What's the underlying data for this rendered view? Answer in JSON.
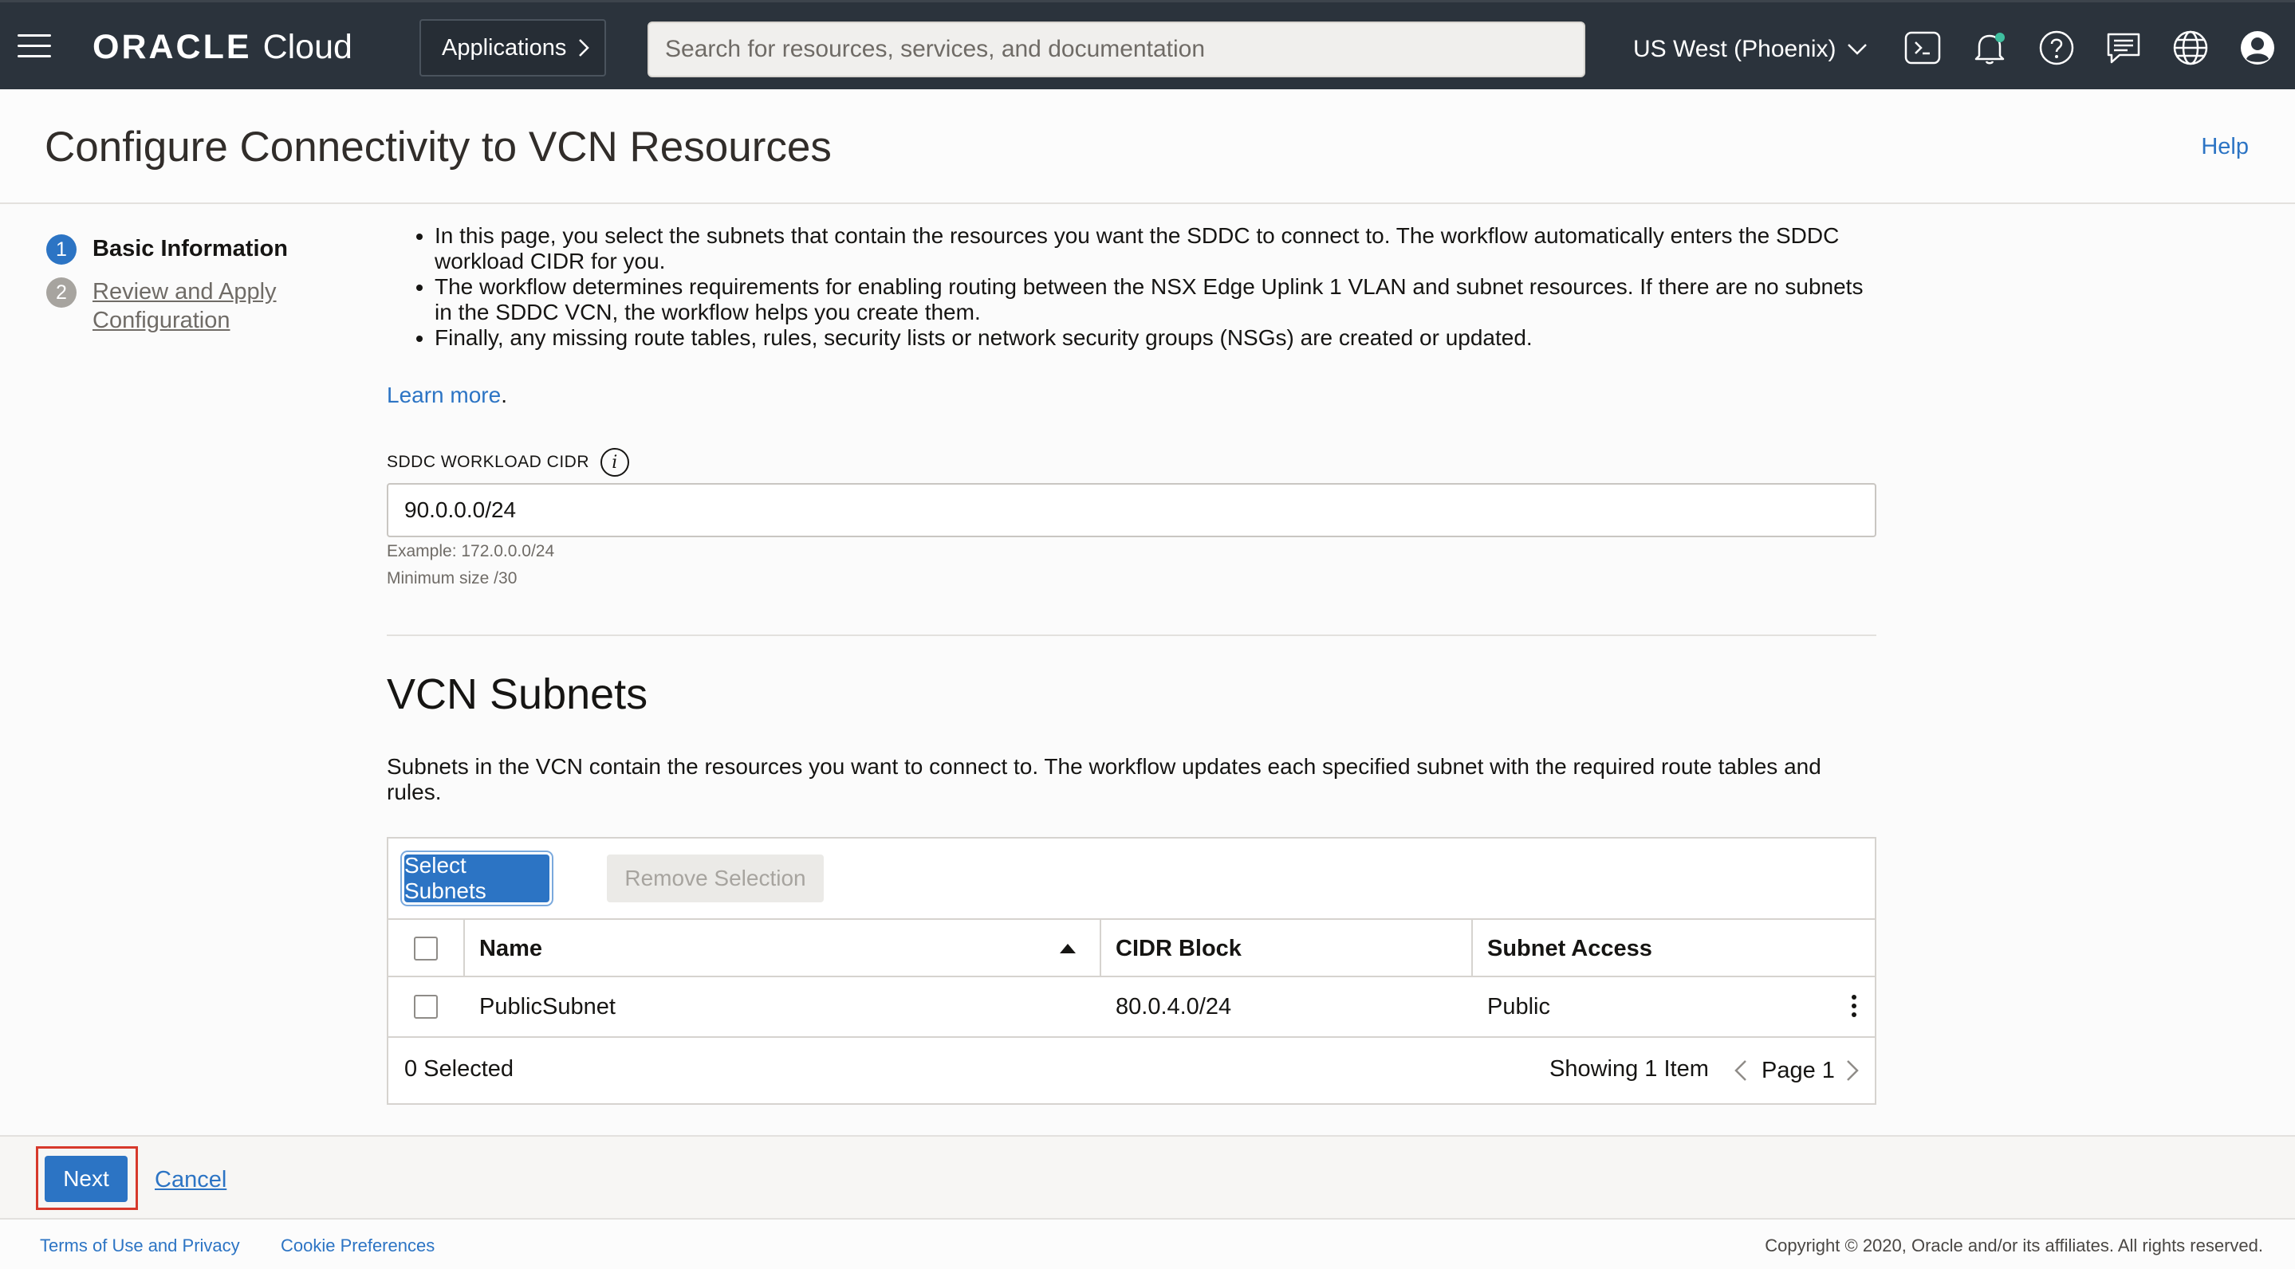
{
  "topbar": {
    "logo_brand": "ORACLE",
    "logo_product": "Cloud",
    "applications_label": "Applications",
    "search_placeholder": "Search for resources, services, and documentation",
    "region": "US West (Phoenix)",
    "icons": [
      "menu-icon",
      "cloud-shell-icon",
      "bell-icon",
      "help-icon",
      "chat-icon",
      "globe-icon",
      "profile-icon"
    ]
  },
  "header": {
    "title": "Configure Connectivity to VCN Resources",
    "help_label": "Help"
  },
  "steps": [
    {
      "number": "1",
      "label": "Basic Information",
      "state": "active"
    },
    {
      "number": "2",
      "label_line1": "Review and Apply",
      "label_line2": "Configuration",
      "state": "inactive"
    }
  ],
  "intro": {
    "bullets": [
      "In this page, you select the subnets that contain the resources you want the SDDC to connect to. The workflow automatically enters the SDDC workload CIDR for you.",
      "The workflow determines requirements for enabling routing between the NSX Edge Uplink 1 VLAN and subnet resources. If there are no subnets in the SDDC VCN, the workflow helps you create them.",
      "Finally, any missing route tables, rules, security lists or network security groups (NSGs) are created or updated."
    ],
    "learn_more": "Learn more",
    "learn_more_suffix": "."
  },
  "cidr_field": {
    "label": "SDDC WORKLOAD CIDR",
    "info_glyph": "i",
    "value": "90.0.0.0/24",
    "hint_example": "Example: 172.0.0.0/24",
    "hint_min": "Minimum size /30"
  },
  "vcn_subnets": {
    "title": "VCN Subnets",
    "description": "Subnets in the VCN contain the resources you want to connect to. The workflow updates each specified subnet with the required route tables and rules.",
    "select_button": "Select Subnets",
    "remove_button": "Remove Selection",
    "columns": [
      "Name",
      "CIDR Block",
      "Subnet Access"
    ],
    "rows": [
      {
        "name": "PublicSubnet",
        "cidr": "80.0.4.0/24",
        "access": "Public"
      }
    ],
    "selected_count": "0 Selected",
    "showing": "Showing 1 Item",
    "page": "Page 1"
  },
  "actions": {
    "next": "Next",
    "cancel": "Cancel"
  },
  "footer": {
    "terms": "Terms of Use and Privacy",
    "cookies": "Cookie Preferences",
    "copyright": "Copyright © 2020, Oracle and/or its affiliates. All rights reserved."
  },
  "colors": {
    "nav_bg": "#2b333c",
    "accent": "#2c74c4",
    "highlight": "#d7392b",
    "notification_dot": "#3fbf9f"
  }
}
